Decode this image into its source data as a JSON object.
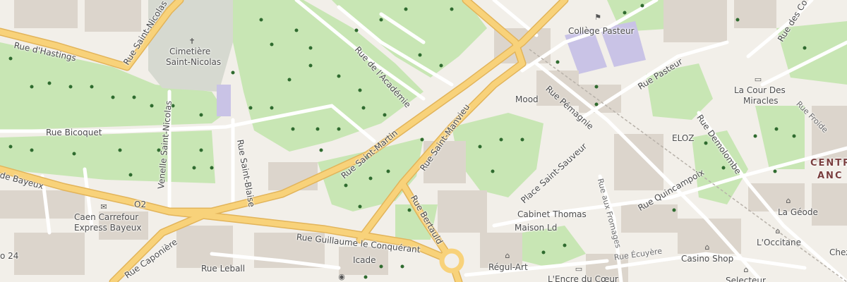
{
  "map": {
    "street_labels": {
      "hastings": "Rue d'Hastings",
      "saint_nicolas": "Rue Saint-Nicolas",
      "academie": "Rue de l'Académie",
      "bicoquet": "Rue Bicoquet",
      "venelle": "Venelle Saint-Nicolas",
      "saint_blaise": "Rue Saint-Blaise",
      "saint_martin": "Rue Saint-Martin",
      "saint_manvieu": "Rue Saint-Manvieu",
      "bayeux": "de Bayeux",
      "bertauld": "Rue Bertauld",
      "guillaume": "Rue Guillaume le Conquérant",
      "caponiere": "Rue Caponière",
      "leballeur": "Rue Leball",
      "pernagnie": "Rue Pémagnie",
      "pasteur": "Rue Pasteur",
      "saint_sauveur": "Place Saint-Sauveur",
      "fromages": "Rue aux Fromages",
      "quincampoix": "Rue Quincampoix",
      "demolombe": "Rue Demolombe",
      "ecuyere": "Rue Écuyère",
      "froide": "Rue Froide",
      "des_cordes": "Rue des Co"
    },
    "poi_labels": {
      "cimetiere_1": "Cimetière",
      "cimetiere_2": "Saint-Nicolas",
      "college": "Collège Pasteur",
      "mood": "Mood",
      "eloz": "ELOZ",
      "cour_1": "La Cour Des",
      "cour_2": "Miracles",
      "carrefour_1": "Caen Carrefour",
      "carrefour_2": "Express Bayeux",
      "o2": "O2",
      "cabinet": "Cabinet Thomas",
      "maison": "Maison Ld",
      "geode": "La Géode",
      "occitane": "L'Occitane",
      "casino": "Casino Shop",
      "icade": "Icade",
      "regul": "Régul-Art",
      "encre": "L'Encre du Cœur",
      "selecteur": "Selecteur",
      "chez": "Chez",
      "bus24": "o 24"
    },
    "district": {
      "line1": "CENTR",
      "line2": "ANC"
    },
    "colors": {
      "background": "#f2efe9",
      "park": "#c8e6b4",
      "building": "#dcd5cc",
      "primary_road": "#f8d27a",
      "minor_road": "#ffffff",
      "school": "#c9c3e6"
    },
    "icons": {
      "cemetery": "cemetery-icon",
      "school": "school-icon",
      "tree": "tree-icon",
      "shop": "shop-icon",
      "mail": "mail-icon",
      "book": "book-icon",
      "camera": "camera-icon"
    }
  }
}
